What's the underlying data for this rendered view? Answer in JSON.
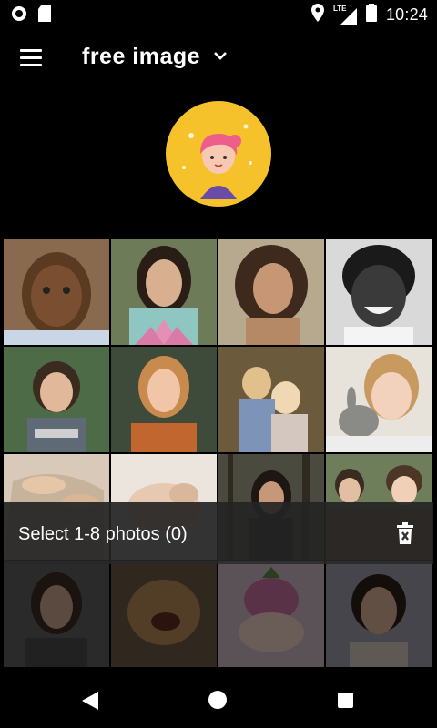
{
  "status_bar": {
    "time": "10:24",
    "network": "LTE",
    "icons": [
      "circle-indicator-icon",
      "sd-card-icon",
      "location-pin-icon",
      "lte-signal-icon",
      "battery-icon"
    ]
  },
  "app_bar": {
    "title": "free image",
    "menu_icon": "hamburger-menu-icon",
    "dropdown_icon": "chevron-down-icon"
  },
  "profile": {
    "avatar_icon": "girl-avatar-illustration"
  },
  "selection_bar": {
    "text": "Select 1-8 photos (0)",
    "delete_icon": "trash-icon"
  },
  "photos": [
    {
      "id": "photo-1",
      "desc": "portrait girl curly hair"
    },
    {
      "id": "photo-2",
      "desc": "portrait girl with lotus"
    },
    {
      "id": "photo-3",
      "desc": "portrait woman curly hair"
    },
    {
      "id": "photo-4",
      "desc": "portrait smiling child"
    },
    {
      "id": "photo-5",
      "desc": "portrait boy outdoors"
    },
    {
      "id": "photo-6",
      "desc": "portrait smiling woman"
    },
    {
      "id": "photo-7",
      "desc": "two girls hugging"
    },
    {
      "id": "photo-8",
      "desc": "girl with rabbit"
    },
    {
      "id": "photo-9",
      "desc": "hands on sheet"
    },
    {
      "id": "photo-10",
      "desc": "baby sleeping"
    },
    {
      "id": "photo-11",
      "desc": "woman in forest"
    },
    {
      "id": "photo-12",
      "desc": "children group"
    },
    {
      "id": "photo-13",
      "desc": "portrait girl dark"
    },
    {
      "id": "photo-14",
      "desc": "lion roaring"
    },
    {
      "id": "photo-15",
      "desc": "baby in flower hat"
    },
    {
      "id": "photo-16",
      "desc": "portrait little girl"
    }
  ],
  "colors": {
    "background": "#000000",
    "selection_bar": "#2a2a2a",
    "avatar_yellow": "#F6C22B"
  }
}
